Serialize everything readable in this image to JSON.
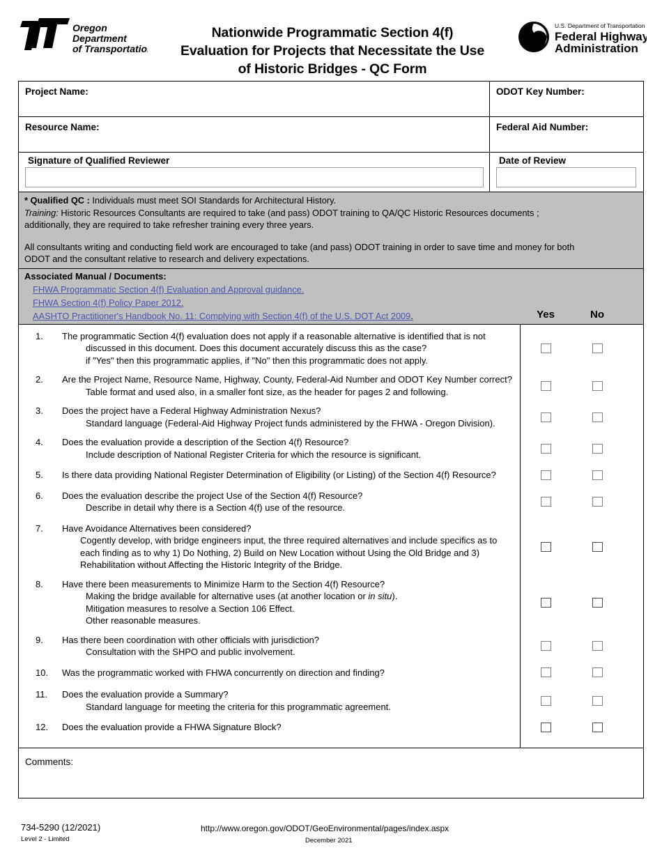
{
  "header": {
    "odot_logo_alt": "Oregon Department of Transportation",
    "odot_logo_line1": "Oregon",
    "odot_logo_line2": "Department",
    "odot_logo_line3": "of Transportation",
    "fhwa_logo_small": "U.S. Department of Transportation",
    "fhwa_logo_line1": "Federal Highway",
    "fhwa_logo_line2": "Administration",
    "title_line1": "Nationwide Programmatic Section 4(f)",
    "title_line2": "Evaluation for Projects that Necessitate the Use",
    "title_line3": "of Historic Bridges - QC Form"
  },
  "info": {
    "project_name_label": "Project Name:",
    "odot_key_label": "ODOT Key Number:",
    "resource_name_label": "Resource Name:",
    "federal_aid_label": "Federal Aid Number:",
    "signature_label": "Signature of Qualified Reviewer",
    "date_of_review_label": "Date of Review",
    "project_name_value": "",
    "odot_key_value": "",
    "resource_name_value": "",
    "federal_aid_value": "",
    "signature_value": "",
    "date_of_review_value": ""
  },
  "notes": {
    "qualified_qc_bold": "* Qualified QC :",
    "qualified_qc_rest": " Individuals must meet SOI Standards for Architectural History.",
    "training_label": "Training:",
    "training_line1": " Historic Resources Consultants are required to take (and pass) ODOT training to QA/QC Historic Resources documents ;",
    "training_line2": "additionally, they are required to take refresher training every three years.",
    "consultants_line1": "All consultants writing and conducting field work are encouraged to take (and pass) ODOT training in order to save time and money for both",
    "consultants_line2": "ODOT and the consultant relative to research and delivery expectations."
  },
  "documents": {
    "title": "Associated Manual / Documents:",
    "links": [
      {
        "text": "FHWA Programmatic Section 4(f) Evaluation and Approval guidance.",
        "tail": ""
      },
      {
        "text": "FHWA Section 4(f) Policy Paper 2012.",
        "tail": ""
      },
      {
        "text": "AASHTO Practitioner's Handbook No. 11: Complying with Section 4(f) of the U.S. DOT Act 2009",
        "tail": "."
      }
    ],
    "yes_header": "Yes",
    "no_header": "No"
  },
  "questions": [
    {
      "num": "1.",
      "main": "The programmatic Section 4(f) evaluation does not apply if a reasonable alternative is identified that is not",
      "subs": [
        "discussed in this document. Does this document accurately discuss this as the case?",
        "if \"Yes\" then this programmatic applies, if \"No\" then this programmatic does not apply."
      ],
      "yes_checked": false,
      "no_checked": false
    },
    {
      "num": "2.",
      "main": "Are the Project Name, Resource Name, Highway, County, Federal-Aid Number and ODOT Key Number correct?",
      "subs": [
        "Table format and used also, in a smaller font size, as the header for pages 2 and following."
      ],
      "yes_checked": false,
      "no_checked": false
    },
    {
      "num": "3.",
      "main": "Does the project have a Federal Highway Administration Nexus?",
      "subs": [
        "Standard language (Federal-Aid Highway Project funds administered by the FHWA - Oregon Division)."
      ],
      "yes_checked": false,
      "no_checked": false
    },
    {
      "num": "4.",
      "main": "Does the evaluation provide a description of the Section 4(f) Resource?",
      "subs": [
        "Include description of National Register Criteria for which the resource is significant."
      ],
      "yes_checked": false,
      "no_checked": false
    },
    {
      "num": "5.",
      "main": "Is there data providing National Register Determination of Eligibility (or Listing) of the Section 4(f) Resource?",
      "subs": [],
      "yes_checked": false,
      "no_checked": false
    },
    {
      "num": "6.",
      "main": "Does the evaluation describe the project Use of the Section 4(f) Resource?",
      "subs": [
        "Describe in detail why there is a Section 4(f) use of the resource."
      ],
      "yes_checked": false,
      "no_checked": false
    },
    {
      "num": "7.",
      "main": "Have Avoidance Alternatives been considered?",
      "subs": [
        "Cogently develop, with bridge engineers input, the three required alternatives and include specifics as to",
        "each finding as to   why 1) Do Nothing, 2) Build on New Location without Using the Old Bridge and 3)",
        "Rehabilitation without Affecting the Historic Integrity of the Bridge."
      ],
      "yes_checked": false,
      "no_checked": false
    },
    {
      "num": "8.",
      "main": "Have there been measurements to Minimize Harm to the Section 4(f) Resource?",
      "subs": [
        "Making the bridge available for alternative uses (at another location or in situ).",
        "Mitigation measures to resolve a Section 106 Effect.",
        "Other reasonable measures."
      ],
      "italic_phrase": "in situ",
      "yes_checked": false,
      "no_checked": false
    },
    {
      "num": "9.",
      "main": "Has there been coordination with other officials with jurisdiction?",
      "subs": [
        "Consultation with the SHPO and public involvement."
      ],
      "yes_checked": false,
      "no_checked": false
    },
    {
      "num": "10.",
      "main": "Was the programmatic worked with FHWA concurrently on direction and finding?",
      "subs": [],
      "yes_checked": false,
      "no_checked": false
    },
    {
      "num": "11.",
      "main": "Does the evaluation provide a Summary?",
      "subs": [
        "Standard language for meeting the criteria for this programmatic agreement."
      ],
      "yes_checked": false,
      "no_checked": false
    },
    {
      "num": "12.",
      "main": "Does the evaluation provide a FHWA Signature Block?",
      "subs": [],
      "yes_checked": false,
      "no_checked": false
    }
  ],
  "comments": {
    "label": "Comments:",
    "value": ""
  },
  "footer": {
    "form_number": "734-5290 (12/2021)",
    "level": "Level 2 - Limited",
    "url": "http://www.oregon.gov/ODOT/GeoEnvironmental/pages/index.aspx",
    "date": "December 2021"
  },
  "colors": {
    "gray_band": "#c0c0c0",
    "link": "#4a54ad",
    "border": "#000000",
    "checkbox_border": "#808080"
  }
}
